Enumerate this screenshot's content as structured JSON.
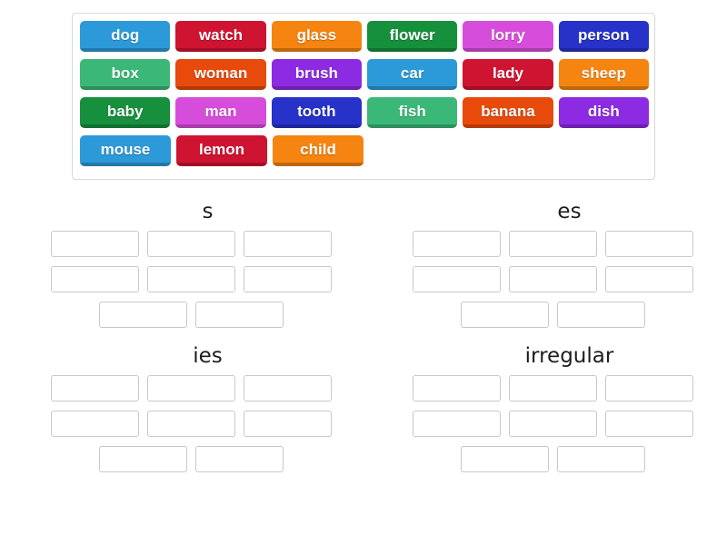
{
  "activity": {
    "type": "group-sort",
    "word_bank": {
      "rows": [
        [
          {
            "label": "dog",
            "color": "#2c9ad9"
          },
          {
            "label": "watch",
            "color": "#cf1431"
          },
          {
            "label": "glass",
            "color": "#f58410"
          },
          {
            "label": "flower",
            "color": "#17903e"
          },
          {
            "label": "lorry",
            "color": "#d74ddb"
          },
          {
            "label": "person",
            "color": "#2632c8"
          }
        ],
        [
          {
            "label": "box",
            "color": "#3bb878"
          },
          {
            "label": "woman",
            "color": "#e84a0c"
          },
          {
            "label": "brush",
            "color": "#8c2be2"
          },
          {
            "label": "car",
            "color": "#2c9ad9"
          },
          {
            "label": "lady",
            "color": "#cf1431"
          },
          {
            "label": "sheep",
            "color": "#f58410"
          }
        ],
        [
          {
            "label": "baby",
            "color": "#17903e"
          },
          {
            "label": "man",
            "color": "#d74ddb"
          },
          {
            "label": "tooth",
            "color": "#2632c8"
          },
          {
            "label": "fish",
            "color": "#3bb878"
          },
          {
            "label": "banana",
            "color": "#e84a0c"
          },
          {
            "label": "dish",
            "color": "#8c2be2"
          }
        ],
        [
          {
            "label": "mouse",
            "color": "#2c9ad9"
          },
          {
            "label": "lemon",
            "color": "#cf1431"
          },
          {
            "label": "child",
            "color": "#f58410"
          }
        ]
      ]
    },
    "categories": [
      {
        "title": "s",
        "slot_rows": [
          [
            "",
            "",
            ""
          ],
          [
            "",
            "",
            ""
          ],
          [
            "",
            ""
          ]
        ]
      },
      {
        "title": "es",
        "slot_rows": [
          [
            "",
            "",
            ""
          ],
          [
            "",
            "",
            ""
          ],
          [
            "",
            ""
          ]
        ]
      },
      {
        "title": "ies",
        "slot_rows": [
          [
            "",
            "",
            ""
          ],
          [
            "",
            "",
            ""
          ],
          [
            "",
            ""
          ]
        ]
      },
      {
        "title": "irregular",
        "slot_rows": [
          [
            "",
            "",
            ""
          ],
          [
            "",
            "",
            ""
          ],
          [
            "",
            ""
          ]
        ]
      }
    ]
  }
}
